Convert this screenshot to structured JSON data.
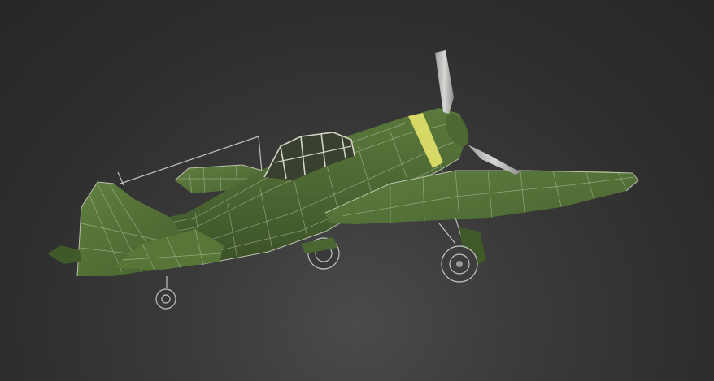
{
  "viewport": {
    "background_color": "#333333",
    "model_color": "#4e6a34",
    "wire_color": "#c9cfb8",
    "band_color": "#e3e36a"
  }
}
